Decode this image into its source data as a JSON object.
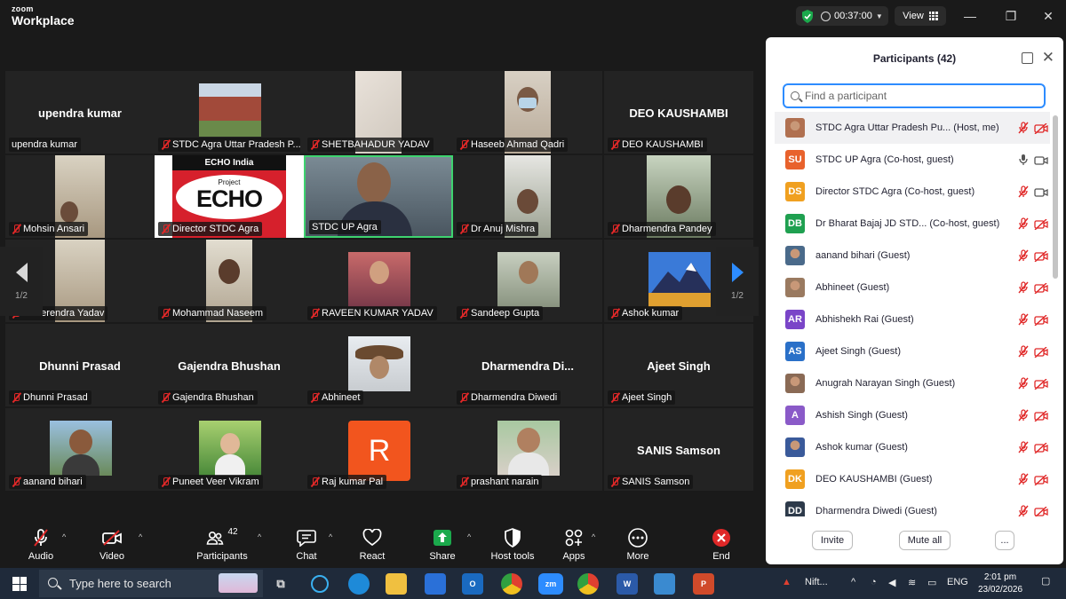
{
  "titlebar": {
    "brand_small": "zoom",
    "brand_large": "Workplace",
    "timer": "00:37:00",
    "view_label": "View",
    "colors": {
      "shield": "#1ba94c",
      "accent": "#2d8cff",
      "active_speaker": "#3ed36f"
    }
  },
  "gallery": {
    "page_left": "1/2",
    "page_right": "1/2",
    "tiles": [
      {
        "name": "upendra kumar",
        "big": "upendra kumar",
        "kind": "name"
      },
      {
        "name": "STDC Agra Uttar Pradesh P...",
        "kind": "building"
      },
      {
        "name": "SHETBAHADUR YADAV",
        "kind": "wall"
      },
      {
        "name": "Haseeb Ahmad Qadri",
        "kind": "person-mask"
      },
      {
        "name": "DEO KAUSHAMBI",
        "big": "DEO KAUSHAMBI",
        "kind": "name"
      },
      {
        "name": "Mohsin Ansari",
        "kind": "room"
      },
      {
        "name": "Director STDC Agra",
        "kind": "echo",
        "echo_top": "ECHO India",
        "echo_project": "Project",
        "echo_word": "ECHO"
      },
      {
        "name": "STDC UP Agra",
        "kind": "person",
        "active": true
      },
      {
        "name": "Dr Anuj Mishra",
        "kind": "person-room"
      },
      {
        "name": "Dharmendra Pandey",
        "kind": "person-room"
      },
      {
        "name": "Dheerendra Yadav",
        "kind": "room"
      },
      {
        "name": "Mohammad Naseem",
        "kind": "person-room"
      },
      {
        "name": "RAVEEN KUMAR YADAV",
        "kind": "avatar"
      },
      {
        "name": "Sandeep Gupta",
        "kind": "avatar"
      },
      {
        "name": "Ashok kumar",
        "kind": "mountain"
      },
      {
        "name": "Dhunni Prasad",
        "big": "Dhunni Prasad",
        "kind": "name"
      },
      {
        "name": "Gajendra Bhushan",
        "big": "Gajendra Bhushan",
        "kind": "name"
      },
      {
        "name": "Abhineet",
        "kind": "avatar-hat"
      },
      {
        "name": "Dharmendra Diwedi",
        "big": "Dharmendra  Di...",
        "kind": "name"
      },
      {
        "name": "Ajeet Singh",
        "big": "Ajeet Singh",
        "kind": "name"
      },
      {
        "name": "aanand bihari",
        "kind": "avatar-outdoor"
      },
      {
        "name": "Puneet Veer Vikram",
        "kind": "avatar-child"
      },
      {
        "name": "Raj kumar Pal",
        "kind": "letter",
        "letter": "R"
      },
      {
        "name": "prashant narain",
        "kind": "avatar"
      },
      {
        "name": "SANIS Samson",
        "big": "SANIS Samson",
        "kind": "name"
      }
    ]
  },
  "toolbar": {
    "audio": "Audio",
    "video": "Video",
    "participants": "Participants",
    "participants_count": "42",
    "chat": "Chat",
    "react": "React",
    "share": "Share",
    "host_tools": "Host tools",
    "apps": "Apps",
    "more": "More",
    "end": "End"
  },
  "panel": {
    "title": "Participants (42)",
    "search_placeholder": "Find a participant",
    "participants": [
      {
        "name": "STDC Agra Uttar Pradesh Pu...",
        "role": "(Host, me)",
        "avatar": "img",
        "color": "#b07050",
        "mic": "muted",
        "cam": "off"
      },
      {
        "name": "STDC UP Agra",
        "role": "(Co-host, guest)",
        "avatar": "SU",
        "color": "#e8622c",
        "mic": "on",
        "cam": "on"
      },
      {
        "name": "Director STDC Agra",
        "role": "(Co-host, guest)",
        "avatar": "DS",
        "color": "#f0a020",
        "mic": "muted",
        "cam": "on"
      },
      {
        "name": "Dr Bharat Bajaj JD STD...",
        "role": "(Co-host, guest)",
        "avatar": "DB",
        "color": "#1fa050",
        "mic": "muted",
        "cam": "off"
      },
      {
        "name": "aanand bihari",
        "role": "(Guest)",
        "avatar": "img",
        "color": "#4a6a8a",
        "mic": "muted",
        "cam": "off"
      },
      {
        "name": "Abhineet",
        "role": "(Guest)",
        "avatar": "img",
        "color": "#9a7a60",
        "mic": "muted",
        "cam": "off"
      },
      {
        "name": "Abhishekh Rai",
        "role": "(Guest)",
        "avatar": "AR",
        "color": "#7a45c8",
        "mic": "muted",
        "cam": "off"
      },
      {
        "name": "Ajeet Singh",
        "role": "(Guest)",
        "avatar": "AS",
        "color": "#2a70c8",
        "mic": "muted",
        "cam": "off"
      },
      {
        "name": "Anugrah Narayan Singh",
        "role": "(Guest)",
        "avatar": "img",
        "color": "#8a6a55",
        "mic": "muted",
        "cam": "off"
      },
      {
        "name": "Ashish Singh",
        "role": "(Guest)",
        "avatar": "A",
        "color": "#8a5ac8",
        "mic": "muted",
        "cam": "off"
      },
      {
        "name": "Ashok kumar",
        "role": "(Guest)",
        "avatar": "img",
        "color": "#3a5a9a",
        "mic": "muted",
        "cam": "off"
      },
      {
        "name": "DEO KAUSHAMBI",
        "role": "(Guest)",
        "avatar": "DK",
        "color": "#f0a020",
        "mic": "muted",
        "cam": "off"
      },
      {
        "name": "Dharmendra Diwedi",
        "role": "(Guest)",
        "avatar": "DD",
        "color": "#2d3a4a",
        "mic": "muted",
        "cam": "off"
      }
    ],
    "invite": "Invite",
    "mute_all": "Mute all",
    "more": "..."
  },
  "taskbar": {
    "search_placeholder": "Type here to search",
    "widget_label": "Nift...",
    "language": "ENG",
    "time": "2:01 pm",
    "date": "23/02/2026"
  }
}
